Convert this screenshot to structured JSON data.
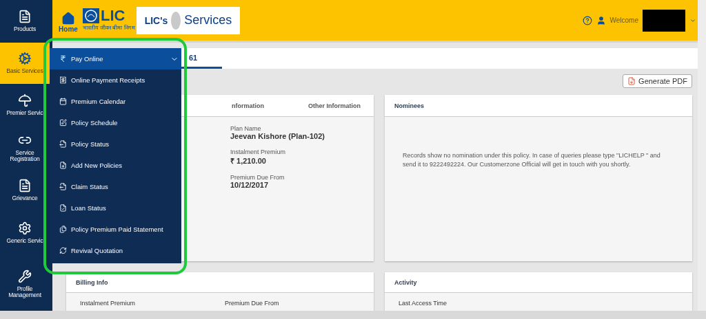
{
  "header": {
    "home_label": "Home",
    "logo_text": "LIC",
    "logo_subtext": "भारतीय जीवन बीमा निगम",
    "eservices_prefix": "LIC's",
    "eservices_text": "Services",
    "welcome": "Welcome"
  },
  "sidebar": {
    "items": [
      {
        "label": "Products",
        "selected": false
      },
      {
        "label": "Basic Services",
        "selected": true
      },
      {
        "label": "Premier Servic",
        "selected": false
      },
      {
        "label": "Service Registration",
        "selected": false
      },
      {
        "label": "Grievance",
        "selected": false
      },
      {
        "label": "Generic Servic",
        "selected": false
      },
      {
        "label": "Profile Management",
        "selected": false
      }
    ]
  },
  "menu": {
    "items": [
      {
        "label": "Pay Online",
        "selected": true
      },
      {
        "label": "Online Payment Receipts",
        "selected": false
      },
      {
        "label": "Premium Calendar",
        "selected": false
      },
      {
        "label": "Policy Schedule",
        "selected": false
      },
      {
        "label": "Policy Status",
        "selected": false
      },
      {
        "label": "Add New Policies",
        "selected": false
      },
      {
        "label": "Claim Status",
        "selected": false
      },
      {
        "label": "Loan Status",
        "selected": false
      },
      {
        "label": "Policy Premium Paid Statement",
        "selected": false
      },
      {
        "label": "Revival Quotation",
        "selected": false
      }
    ]
  },
  "tab": {
    "label": "61",
    "selected": true
  },
  "generate_pdf": "Generate PDF",
  "policy_card": {
    "columns": [
      "nformation",
      "Other Information"
    ],
    "fields": [
      {
        "label": "Plan Name",
        "value": "Jeevan Kishore (Plan-102)"
      },
      {
        "label": "Instalment Premium",
        "value": "₹ 1,210.00"
      },
      {
        "label": "Premium Due From",
        "value": "10/12/2017"
      }
    ]
  },
  "nominees_card": {
    "title": "Nominees",
    "message": "Records show no nomination under this policy. In case of queries please type \"LICHELP \" and send it to 9222492224. Our Customerzone Official will get in touch with you shortly."
  },
  "billing_card": {
    "title": "Billing Info",
    "columns": [
      "Instalment Premium",
      "Premium Due From"
    ]
  },
  "activity_card": {
    "title": "Activity",
    "field": "Last Access Time"
  }
}
